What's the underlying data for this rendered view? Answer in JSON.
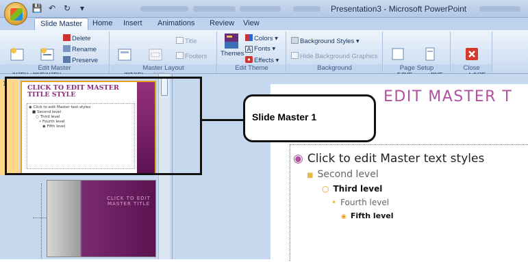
{
  "window": {
    "title": "Presentation3 - Microsoft PowerPoint"
  },
  "tabs": [
    "Slide Master",
    "Home",
    "Insert",
    "Animations",
    "Review",
    "View"
  ],
  "ribbon": {
    "edit_master": {
      "label": "Edit Master",
      "insert_slide_master": "Insert Slide\nMaster",
      "insert_layout": "Insert\nLayout",
      "delete": "Delete",
      "rename": "Rename",
      "preserve": "Preserve"
    },
    "master_layout": {
      "label": "Master Layout",
      "master_layout": "Master\nLayout",
      "insert_placeholder": "Insert\nPlaceholder",
      "title": "Title",
      "footers": "Footers"
    },
    "edit_theme": {
      "label": "Edit Theme",
      "themes": "Themes",
      "colors": "Colors",
      "fonts": "Fonts",
      "effects": "Effects"
    },
    "background": {
      "label": "Background",
      "background_styles": "Background Styles",
      "hide_background_graphics": "Hide Background Graphics"
    },
    "page_setup": {
      "label": "Page Setup",
      "page_setup": "Page\nSetup",
      "slide_orientation": "Slide\nOrientation"
    },
    "close": {
      "label": "Close",
      "close_master_view": "Close\nMaster View"
    }
  },
  "thumbnails": {
    "slide_number": "1",
    "master": {
      "title": "CLICK TO EDIT MASTER TITLE STYLE",
      "levels": [
        "Click to edit Master text styles",
        "Second level",
        "Third level",
        "Fourth level",
        "Fifth level"
      ]
    },
    "layout": {
      "title": "CLICK TO EDIT MASTER TITLE"
    }
  },
  "slide": {
    "title": "EDIT MASTER T",
    "levels": [
      "Click to edit Master text styles",
      "Second level",
      "Third level",
      "Fourth level",
      "Fifth level"
    ]
  },
  "callout": {
    "text": "Slide Master 1"
  },
  "colors": {
    "accent_purple": "#b050a0",
    "highlight_border": "#111111",
    "ribbon_blue": "#c6d8ee"
  }
}
